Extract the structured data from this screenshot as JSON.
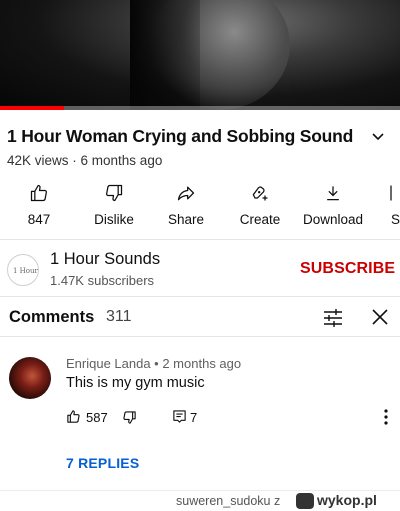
{
  "video": {
    "title": "1 Hour Woman Crying and Sobbing Sound",
    "meta": "42K views · 6 months ago",
    "progress_fraction": 0.16
  },
  "actions": [
    {
      "name": "like-button",
      "icon": "thumb-up-icon",
      "label": "847"
    },
    {
      "name": "dislike-button",
      "icon": "thumb-down-icon",
      "label": "Dislike"
    },
    {
      "name": "share-button",
      "icon": "share-icon",
      "label": "Share"
    },
    {
      "name": "create-button",
      "icon": "create-icon",
      "label": "Create"
    },
    {
      "name": "download-button",
      "icon": "download-icon",
      "label": "Download"
    },
    {
      "name": "save-button",
      "icon": "save-icon",
      "label": "S"
    }
  ],
  "channel": {
    "avatar_text": "1 Hour",
    "name": "1 Hour Sounds",
    "subscribers": "1.47K subscribers",
    "subscribe_label": "SUBSCRIBE"
  },
  "comments": {
    "title": "Comments",
    "count": "311",
    "items": [
      {
        "author": "Enrique Landa • 2 months ago",
        "text": "This is my gym music",
        "likes": "587",
        "replies": "7",
        "replies_link": "7 REPLIES"
      }
    ]
  },
  "watermark": {
    "user": "suweren_sudoku z",
    "site": "wykop.pl"
  },
  "colors": {
    "accent_red": "#cc0000",
    "progress_red": "#ff0000",
    "link_blue": "#065fd4"
  }
}
